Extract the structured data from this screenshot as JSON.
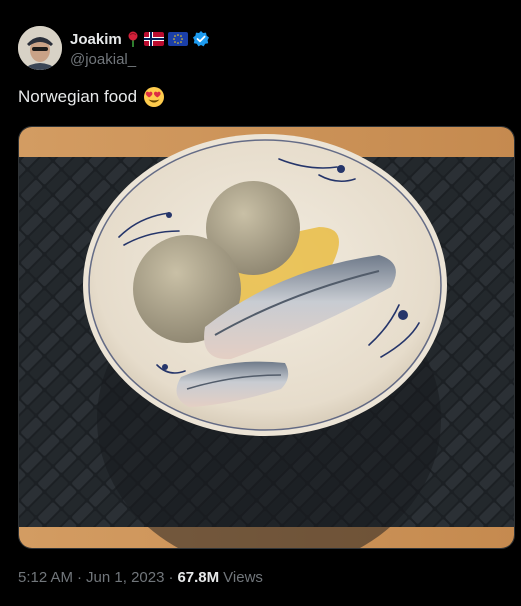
{
  "author": {
    "display_name": "Joakim",
    "handle": "@joakial_",
    "badges": [
      "rose-icon",
      "norway-flag-icon",
      "eu-flag-icon",
      "verified-badge-icon"
    ]
  },
  "tweet": {
    "text": "Norwegian food",
    "emoji": "heart-eyes-emoji"
  },
  "media": {
    "subject": "photo"
  },
  "meta": {
    "time": "5:12 AM",
    "date": "Jun 1, 2023",
    "views_count": "67.8M",
    "views_label": "Views",
    "separator": "·"
  },
  "colors": {
    "background": "#000000",
    "text_primary": "#e7e9ea",
    "text_secondary": "#71767b",
    "verified": "#1d9bf0"
  }
}
